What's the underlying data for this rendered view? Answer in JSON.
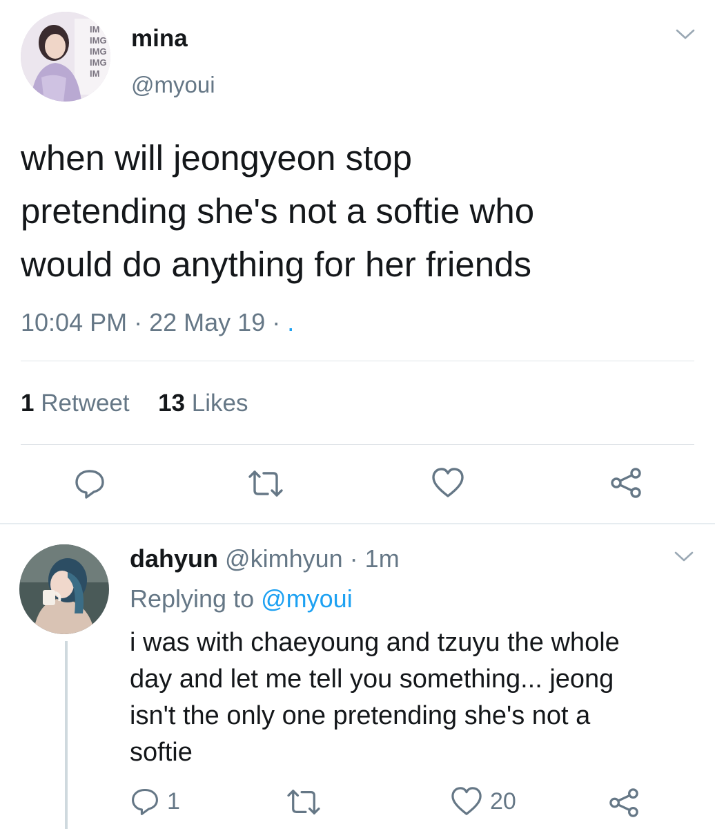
{
  "main_tweet": {
    "display_name": "mina",
    "handle": "@myoui",
    "body_lines": [
      "when will jeongyeon stop",
      "pretending she's not a softie who",
      "would do anything for her friends"
    ],
    "time": "10:04 PM",
    "date": "22 May 19",
    "meta_trail": ".",
    "retweet_count": "1",
    "retweet_label": "Retweet",
    "like_count": "13",
    "like_label": "Likes"
  },
  "reply_tweet": {
    "display_name": "dahyun",
    "handle": "@kimhyun",
    "age": "1m",
    "replying_prefix": "Replying to",
    "replying_handle": "@myoui",
    "body_lines": [
      "i was with chaeyoung and tzuyu the whole",
      "day and let me tell you something... jeong",
      "isn't the only one pretending she's not a",
      "softie"
    ],
    "reply_count": "1",
    "like_count": "20"
  },
  "icons": [
    "chevron-down-icon",
    "reply-icon",
    "retweet-icon",
    "like-icon",
    "share-icon"
  ],
  "colors": {
    "text": "#14171a",
    "muted": "#657786",
    "link": "#1da1f2",
    "divider": "#dfe3e7",
    "thread_line": "#cfd9de"
  }
}
